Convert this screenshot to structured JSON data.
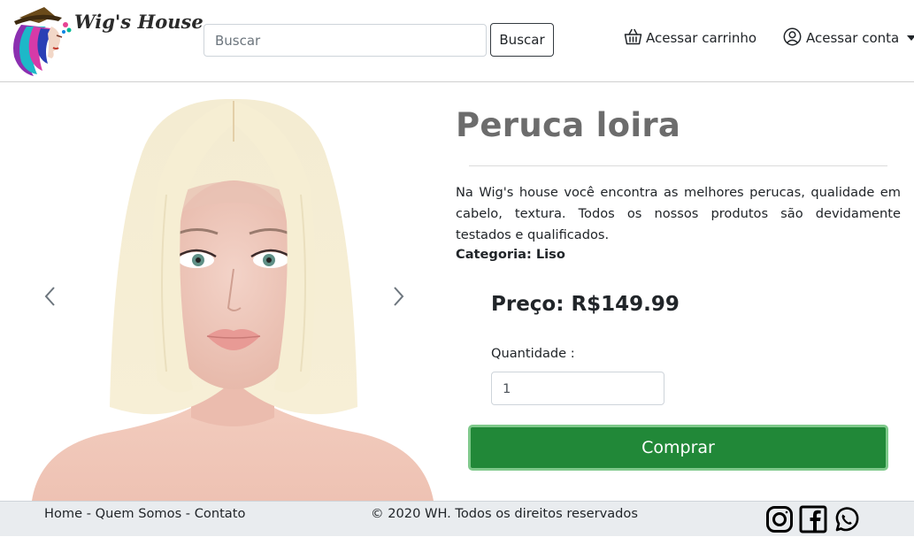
{
  "header": {
    "logo_text": "Wig's House",
    "search": {
      "placeholder": "Buscar",
      "value": ""
    },
    "search_button_label": "Buscar",
    "cart_label": "Acessar carrinho",
    "cart_icon": "basket-icon",
    "account_label": "Acessar conta",
    "account_icon": "user-circle-icon"
  },
  "carousel": {
    "prev_icon": "chevron-left-icon",
    "next_icon": "chevron-right-icon",
    "image_subject": "product-wig-photo"
  },
  "product": {
    "title": "Peruca loira",
    "description": "Na Wig's house você encontra as melhores perucas, qualidade em cabelo, textura. Todos os nossos produtos são devidamente testados e qualificados.",
    "category": "Categoria: Liso",
    "price": "Preço: R$149.99",
    "quantity_label": "Quantidade :",
    "quantity_value": "1",
    "buy_button_label": "Comprar",
    "buy_button_color": "#218838"
  },
  "footer": {
    "link_home": "Home",
    "separator": " - ",
    "link_about": "Quem Somos",
    "link_contact": "Contato",
    "copyright": "© 2020 WH. Todos os direitos reservados",
    "social_icons": [
      "instagram-icon",
      "facebook-icon",
      "whatsapp-icon"
    ]
  }
}
